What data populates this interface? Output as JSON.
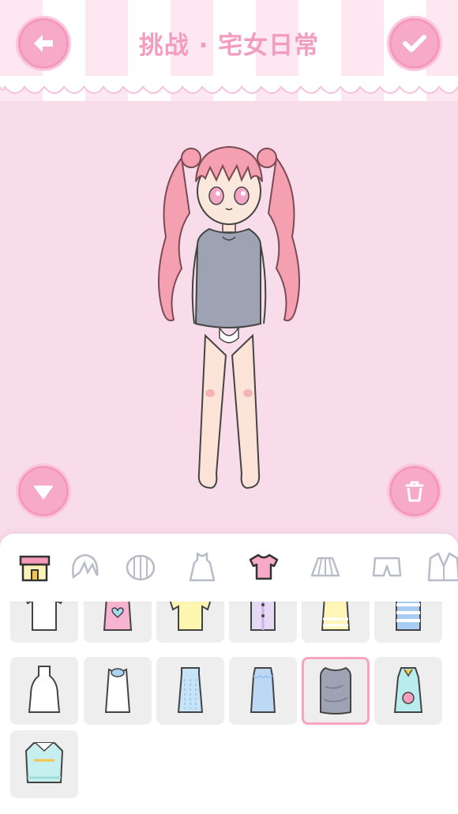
{
  "header": {
    "title": "挑战 · 宅女日常",
    "back_icon": "arrow-left-icon",
    "confirm_icon": "checkmark-icon"
  },
  "stage": {
    "collapse_icon": "triangle-down-icon",
    "trash_icon": "trash-icon"
  },
  "categories": [
    {
      "icon": "shop-icon",
      "name": "shop",
      "active": false
    },
    {
      "icon": "hair-front-icon",
      "name": "bangs",
      "active": false
    },
    {
      "icon": "hair-back-icon",
      "name": "hair",
      "active": false
    },
    {
      "icon": "dress-icon",
      "name": "dress",
      "active": false
    },
    {
      "icon": "shirt-icon",
      "name": "tops",
      "active": true
    },
    {
      "icon": "skirt-icon",
      "name": "skirt",
      "active": false
    },
    {
      "icon": "shorts-icon",
      "name": "shorts",
      "active": false
    },
    {
      "icon": "jacket-icon",
      "name": "jacket",
      "active": false
    }
  ],
  "items": [
    {
      "name": "white-ruffle-tee",
      "color": "#ffffff",
      "accent": "#f6a0c0",
      "selected": false
    },
    {
      "name": "pink-heart-tank",
      "color": "#f7b3cf",
      "accent": "#a8d8f0",
      "selected": false
    },
    {
      "name": "yellow-tee",
      "color": "#fff6b0",
      "accent": "#fff6b0",
      "selected": false
    },
    {
      "name": "lavender-buttoned-top",
      "color": "#e6d9f4",
      "accent": "#c9b3e8",
      "selected": false
    },
    {
      "name": "yellow-striped-tank",
      "color": "#fff6b8",
      "accent": "#ffffff",
      "selected": false
    },
    {
      "name": "blue-striped-tee",
      "color": "#a9cdf2",
      "accent": "#ffffff",
      "selected": false
    },
    {
      "name": "white-halter-top",
      "color": "#ffffff",
      "accent": "#ffffff",
      "selected": false
    },
    {
      "name": "white-frill-top",
      "color": "#ffffff",
      "accent": "#a9d4f3",
      "selected": false
    },
    {
      "name": "light-blue-knit-top",
      "color": "#c7e3f8",
      "accent": "#9fcbef",
      "selected": false
    },
    {
      "name": "blue-lace-top",
      "color": "#bcd8f4",
      "accent": "#9cc3ec",
      "selected": false
    },
    {
      "name": "grey-oversized-tee",
      "color": "#9ea3b4",
      "accent": "#7d8295",
      "selected": true
    },
    {
      "name": "mint-bear-dress",
      "color": "#b9ecec",
      "accent": "#f6a0c0",
      "selected": false
    },
    {
      "name": "mint-collar-sweater",
      "color": "#c8eff0",
      "accent": "#f6c44a",
      "selected": false
    }
  ]
}
